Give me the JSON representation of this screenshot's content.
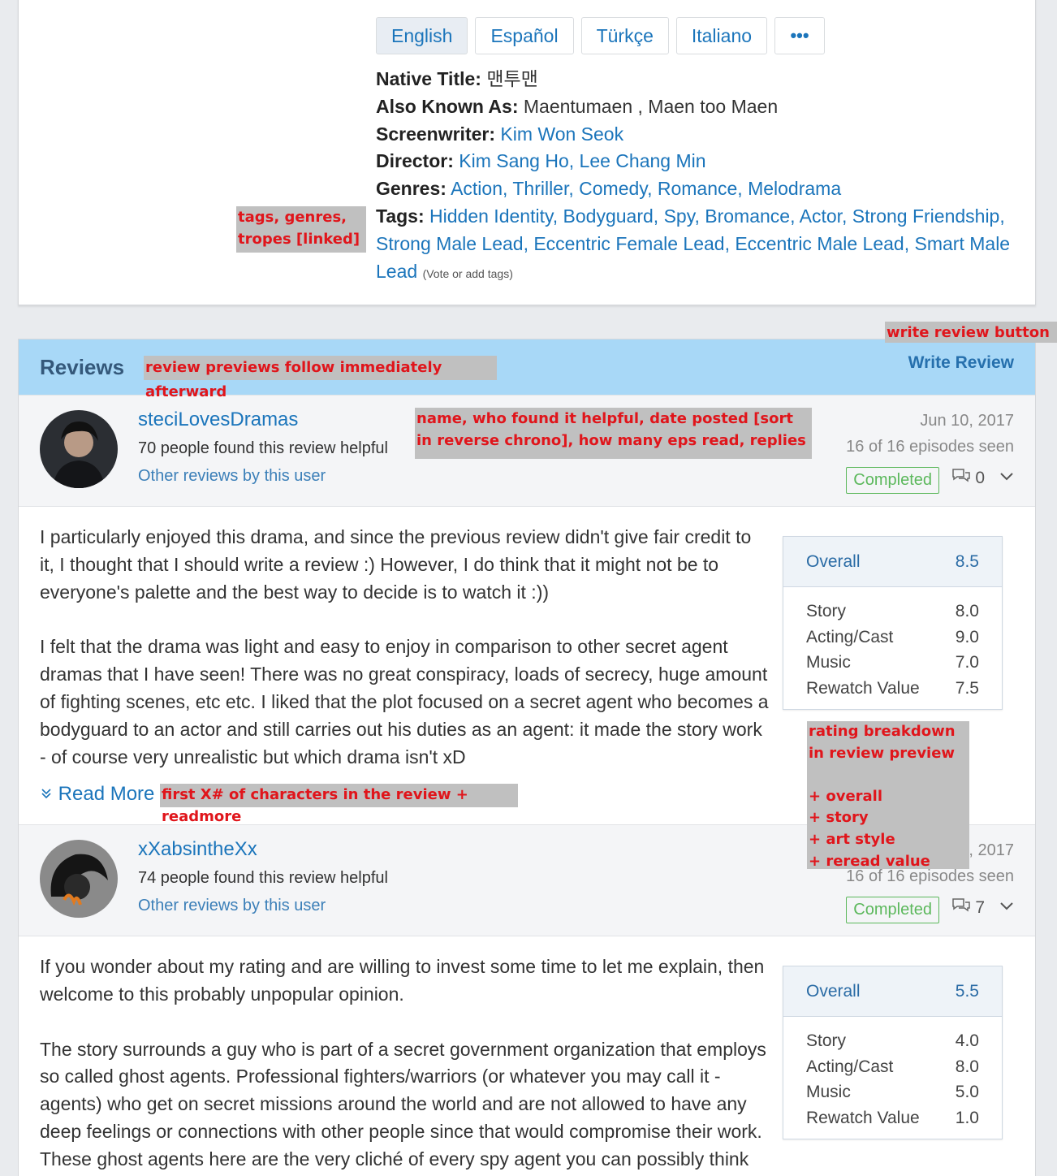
{
  "languages": [
    "English",
    "Español",
    "Türkçe",
    "Italiano"
  ],
  "more_label": "•••",
  "details": {
    "native_title_label": "Native Title:",
    "native_title": "맨투맨",
    "aka_label": "Also Known As:",
    "aka": "Maentumaen , Maen too Maen",
    "screenwriter_label": "Screenwriter:",
    "screenwriter": "Kim Won Seok",
    "director_label": "Director:",
    "director": "Kim Sang Ho, Lee Chang Min",
    "genres_label": "Genres:",
    "genres": "Action, Thriller, Comedy, Romance, Melodrama",
    "tags_label": "Tags:",
    "tags": "Hidden Identity, Bodyguard, Spy, Bromance, Actor, Strong Friendship, Strong Male Lead, Eccentric Female Lead, Eccentric Male Lead, Smart Male Lead",
    "vote_tags": "(Vote or add tags)"
  },
  "annotations": {
    "tags": "tags, genres, tropes [linked]",
    "write_review": "write review button",
    "previews": "review previews follow immediately afterward",
    "meta": "name, who found it helpful, date posted [sort in reverse chrono], how many eps read, replies",
    "excerpt": "first X# of characters in the review + readmore",
    "breakdown": [
      "rating breakdown in review preview",
      "",
      "+ overall",
      "+ story",
      "+ art style",
      "+ reread value"
    ]
  },
  "reviews_section": {
    "title": "Reviews",
    "write_review": "Write Review"
  },
  "reviews": [
    {
      "user": "steciLovesDramas",
      "helpful": "70 people found this review helpful",
      "other_reviews": "Other reviews by this user",
      "date": "Jun 10, 2017",
      "episodes": "16 of 16 episodes seen",
      "status": "Completed",
      "replies": "0",
      "body": [
        "I particularly enjoyed this drama, and since the previous review didn't give fair credit to it, I thought that I should write a review :) However, I do think that it might not be to everyone's palette and the best way to decide is to watch it :))",
        "I felt that the drama was light and easy to enjoy in comparison to other secret agent dramas that I have seen! There was no great conspiracy, loads of secrecy, huge amount of fighting scenes, etc etc. I liked that the plot focused on a secret agent who becomes a bodyguard to an actor and still carries out his duties as an agent: it made the story work - of course very unrealistic but which drama isn't xD"
      ],
      "read_more": "Read More",
      "rating": {
        "overall_label": "Overall",
        "overall": "8.5",
        "rows": [
          {
            "label": "Story",
            "value": "8.0"
          },
          {
            "label": "Acting/Cast",
            "value": "9.0"
          },
          {
            "label": "Music",
            "value": "7.0"
          },
          {
            "label": "Rewatch Value",
            "value": "7.5"
          }
        ]
      }
    },
    {
      "user": "xXabsintheXx",
      "helpful": "74 people found this review helpful",
      "other_reviews": "Other reviews by this user",
      "date": ", 2017",
      "episodes": "16 of 16 episodes seen",
      "status": "Completed",
      "replies": "7",
      "body": [
        "If you wonder about my rating and are willing to invest some time to let me explain, then welcome to this probably unpopular opinion.",
        "The story surrounds a guy who is part of a secret government organization that employs so called ghost agents. Professional fighters/warriors (or whatever you may call it - agents) who get on secret missions around the world and are not allowed to have any deep feelings or connections with other people since that would compromise their work. These ghost agents here are the very cliché of every spy agent you can possibly think of."
      ],
      "rating": {
        "overall_label": "Overall",
        "overall": "5.5",
        "rows": [
          {
            "label": "Story",
            "value": "4.0"
          },
          {
            "label": "Acting/Cast",
            "value": "8.0"
          },
          {
            "label": "Music",
            "value": "5.0"
          },
          {
            "label": "Rewatch Value",
            "value": "1.0"
          }
        ]
      }
    }
  ]
}
